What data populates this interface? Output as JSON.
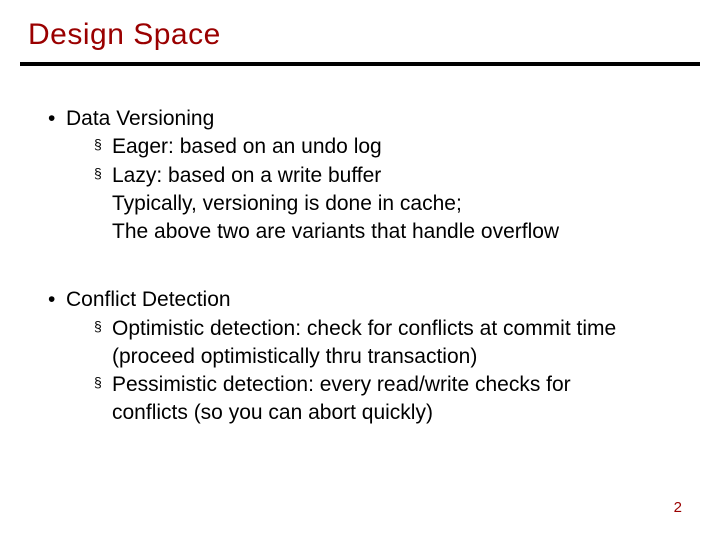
{
  "title": "Design Space",
  "page_number": "2",
  "groups": [
    {
      "heading": "Data Versioning",
      "items": [
        {
          "lines": [
            "Eager: based on an undo log"
          ]
        },
        {
          "lines": [
            "Lazy: based on a write buffer",
            "Typically, versioning is done in cache;",
            "The above two are variants that handle overflow"
          ]
        }
      ]
    },
    {
      "heading": "Conflict Detection",
      "items": [
        {
          "lines": [
            "Optimistic detection: check for conflicts at commit time",
            "(proceed optimistically thru transaction)"
          ]
        },
        {
          "lines": [
            "Pessimistic detection: every read/write checks for",
            "conflicts (so you can abort quickly)"
          ]
        }
      ]
    }
  ],
  "bullets": {
    "level1": "•",
    "level2": "§"
  }
}
